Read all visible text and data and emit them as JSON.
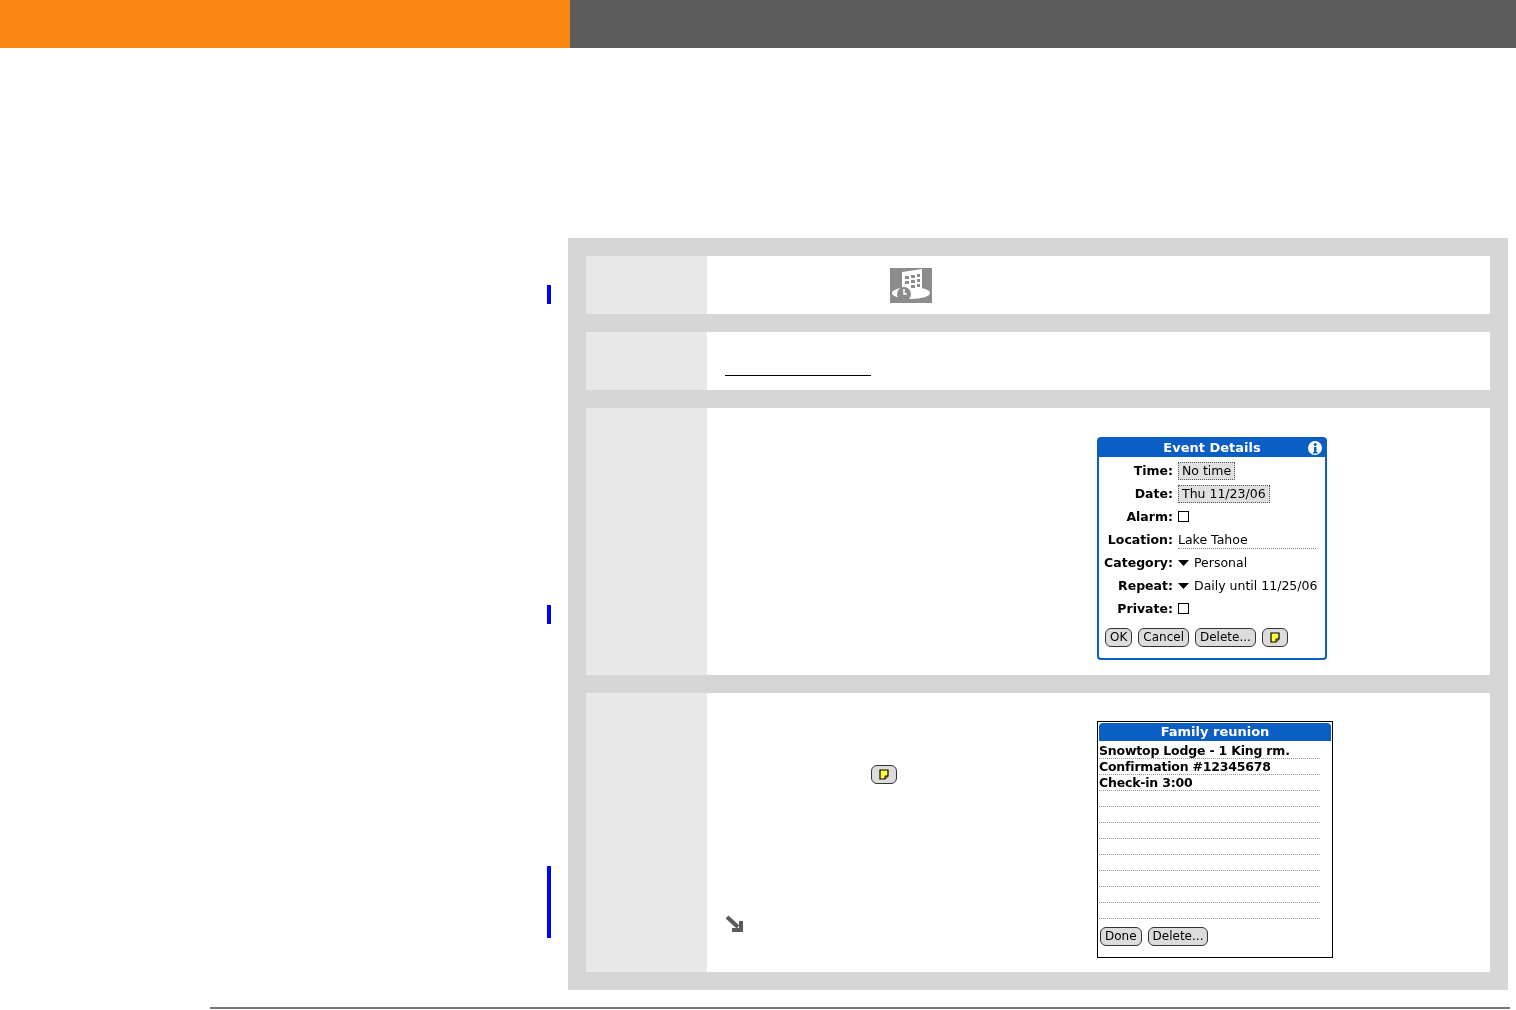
{
  "steps": [
    {
      "kind": "app-icon"
    },
    {
      "kind": "link-rule"
    },
    {
      "kind": "dialog",
      "dialog": {
        "title": "Event Details",
        "fields": [
          {
            "label": "Time:",
            "kind": "selector",
            "value": "No time"
          },
          {
            "label": "Date:",
            "kind": "selector",
            "value": "Thu 11/23/06"
          },
          {
            "label": "Alarm:",
            "kind": "checkbox",
            "checked": false
          },
          {
            "label": "Location:",
            "kind": "text",
            "value": "Lake Tahoe"
          },
          {
            "label": "Category:",
            "kind": "dropdown",
            "value": "Personal"
          },
          {
            "label": "Repeat:",
            "kind": "dropdown",
            "value": "Daily until 11/25/06"
          },
          {
            "label": "Private:",
            "kind": "checkbox",
            "checked": false
          }
        ],
        "buttons": [
          "OK",
          "Cancel",
          "Delete..."
        ]
      }
    },
    {
      "kind": "note",
      "note": {
        "title": "Family reunion",
        "lines": [
          "Snowtop Lodge - 1 King rm.",
          "Confirmation #12345678",
          "Check-in 3:00"
        ],
        "buttons": [
          "Done",
          "Delete..."
        ]
      }
    }
  ]
}
